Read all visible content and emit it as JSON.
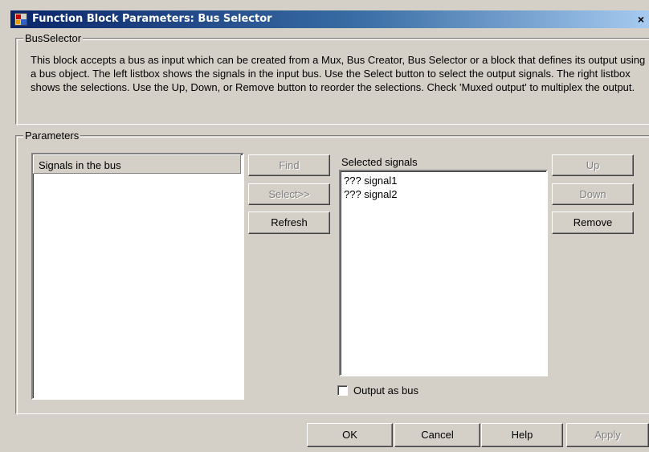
{
  "window": {
    "title": "Function Block Parameters: Bus Selector",
    "close_glyph": "×"
  },
  "bus_selector_group": {
    "label": "BusSelector",
    "description": "This block accepts a bus as input which can be created from a Mux, Bus Creator, Bus Selector or a block that defines its output using a bus object. The left listbox shows the signals in the input bus. Use the Select button to select the output signals. The right listbox shows the selections. Use the Up, Down, or Remove button to reorder the selections. Check 'Muxed output' to multiplex the output."
  },
  "parameters_group": {
    "label": "Parameters",
    "signals_list_header": "Signals in the bus",
    "signals_list_items": [],
    "middle_buttons": {
      "find": "Find",
      "select": "Select>>",
      "refresh": "Refresh"
    },
    "selected_signals_label": "Selected signals",
    "selected_signals": [
      "??? signal1",
      "??? signal2"
    ],
    "right_buttons": {
      "up": "Up",
      "down": "Down",
      "remove": "Remove"
    },
    "output_as_bus": {
      "label": "Output as bus",
      "checked": false
    }
  },
  "dialog_buttons": {
    "ok": "OK",
    "cancel": "Cancel",
    "help": "Help",
    "apply": "Apply"
  },
  "colors": {
    "dialog_face": "#d4d0c8",
    "title_gradient_start": "#0a246a",
    "title_gradient_end": "#a6caf0",
    "disabled_text": "#808080"
  }
}
